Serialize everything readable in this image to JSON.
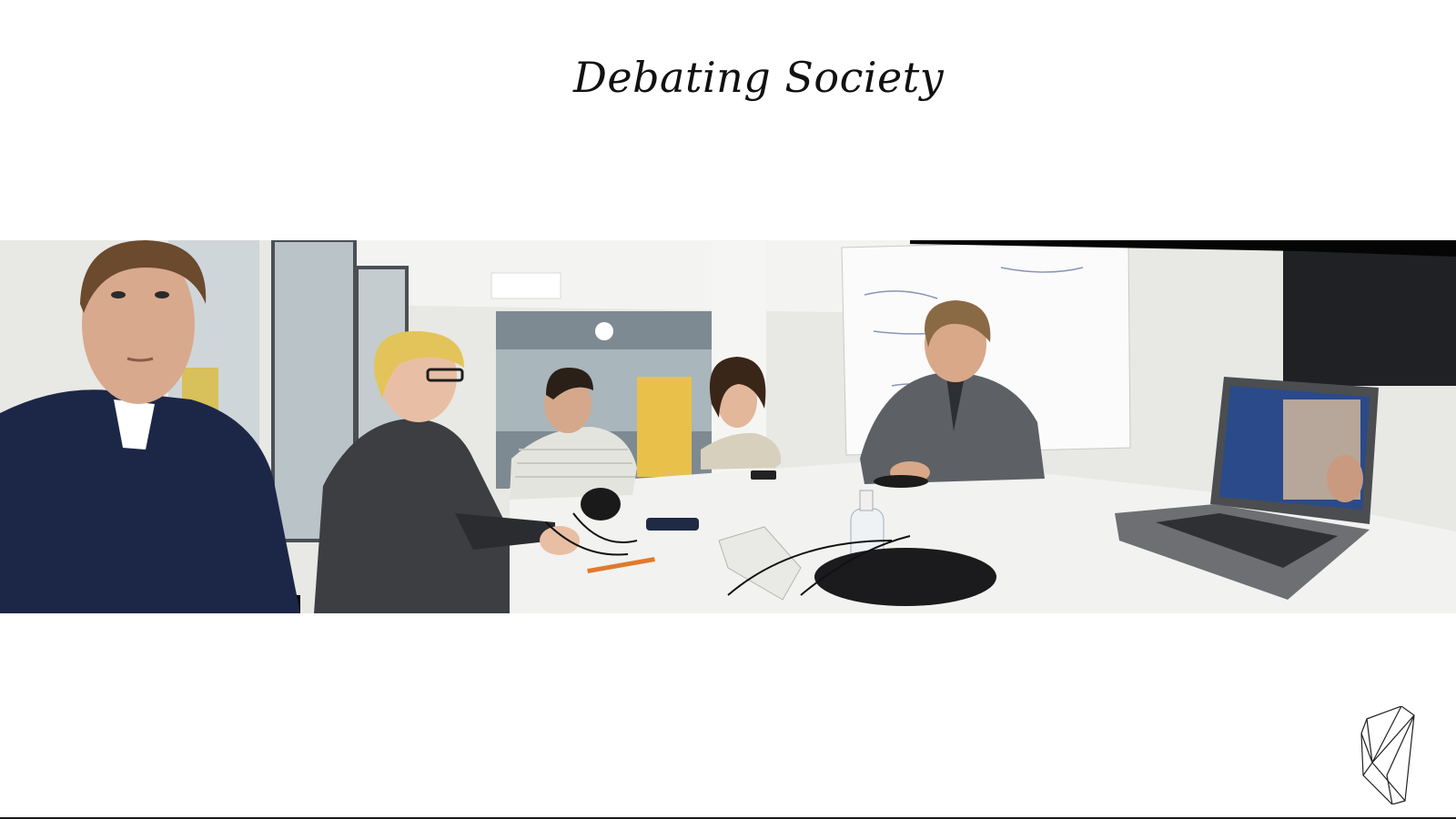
{
  "slide": {
    "title": "Debating Society",
    "photo": {
      "description_icon": "panorama-photo",
      "colors": {
        "wall": "#e9e9e6",
        "table": "#f1f1ef",
        "navy_sweater": "#1c2748",
        "grey_jacket": "#3c3e42",
        "grey_hoodie": "#5d6166",
        "hair_blond": "#e3c45a",
        "laptop": "#6d6f72",
        "screen": "#2b4a8a"
      }
    },
    "logo": {
      "icon": "geometric-crystal-logo-icon"
    }
  }
}
